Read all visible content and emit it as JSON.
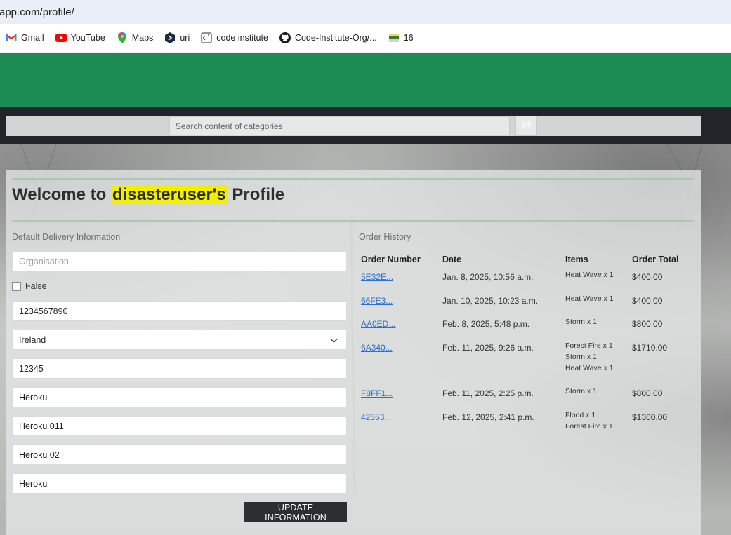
{
  "browser": {
    "url": "app.com/profile/",
    "bookmarks": [
      {
        "label": "Gmail",
        "icon": "gmail-icon"
      },
      {
        "label": "YouTube",
        "icon": "youtube-icon"
      },
      {
        "label": "Maps",
        "icon": "maps-icon"
      },
      {
        "label": "uri",
        "icon": "hexagon-icon"
      },
      {
        "label": "code institute",
        "icon": "code-institute-icon"
      },
      {
        "label": "Code-Institute-Org/...",
        "icon": "github-icon"
      },
      {
        "label": "16",
        "icon": "flag-icon"
      }
    ]
  },
  "header": {
    "accent_color": "#1b8a53"
  },
  "search": {
    "placeholder": "Search content of categories",
    "button_icon": "binoculars-icon"
  },
  "profile": {
    "title_prefix": "Welcome to",
    "username": "disasteruser's",
    "title_suffix": "Profile",
    "delivery_label": "Default Delivery Information",
    "fields": {
      "organisation_placeholder": "Organisation",
      "checkbox_label": "False",
      "phone": "1234567890",
      "country": "Ireland",
      "postcode": "12345",
      "town": "Heroku",
      "street1": "Heroku 011",
      "street2": "Heroku 02",
      "county": "Heroku"
    },
    "update_button": "UPDATE INFORMATION"
  },
  "orders": {
    "label": "Order History",
    "headers": [
      "Order Number",
      "Date",
      "Items",
      "Order Total"
    ],
    "rows": [
      {
        "number": "5E32E...",
        "date": "Jan. 8, 2025, 10:56 a.m.",
        "items": [
          "Heat Wave x 1"
        ],
        "total": "$400.00"
      },
      {
        "number": "66FE3...",
        "date": "Jan. 10, 2025, 10:23 a.m.",
        "items": [
          "Heat Wave x 1"
        ],
        "total": "$400.00"
      },
      {
        "number": "AA0ED...",
        "date": "Feb. 8, 2025, 5:48 p.m.",
        "items": [
          "Storm x 1"
        ],
        "total": "$800.00"
      },
      {
        "number": "6A340...",
        "date": "Feb. 11, 2025, 9:26 a.m.",
        "items": [
          "Forest Fire x 1",
          "Storm x 1",
          "Heat Wave x 1"
        ],
        "total": "$1710.00"
      },
      {
        "number": "F8FF1...",
        "date": "Feb. 11, 2025, 2:25 p.m.",
        "items": [
          "Storm x 1"
        ],
        "total": "$800.00"
      },
      {
        "number": "42553...",
        "date": "Feb. 12, 2025, 2:41 p.m.",
        "items": [
          "Flood x 1",
          "Forest Fire x 1"
        ],
        "total": "$1300.00"
      }
    ]
  }
}
